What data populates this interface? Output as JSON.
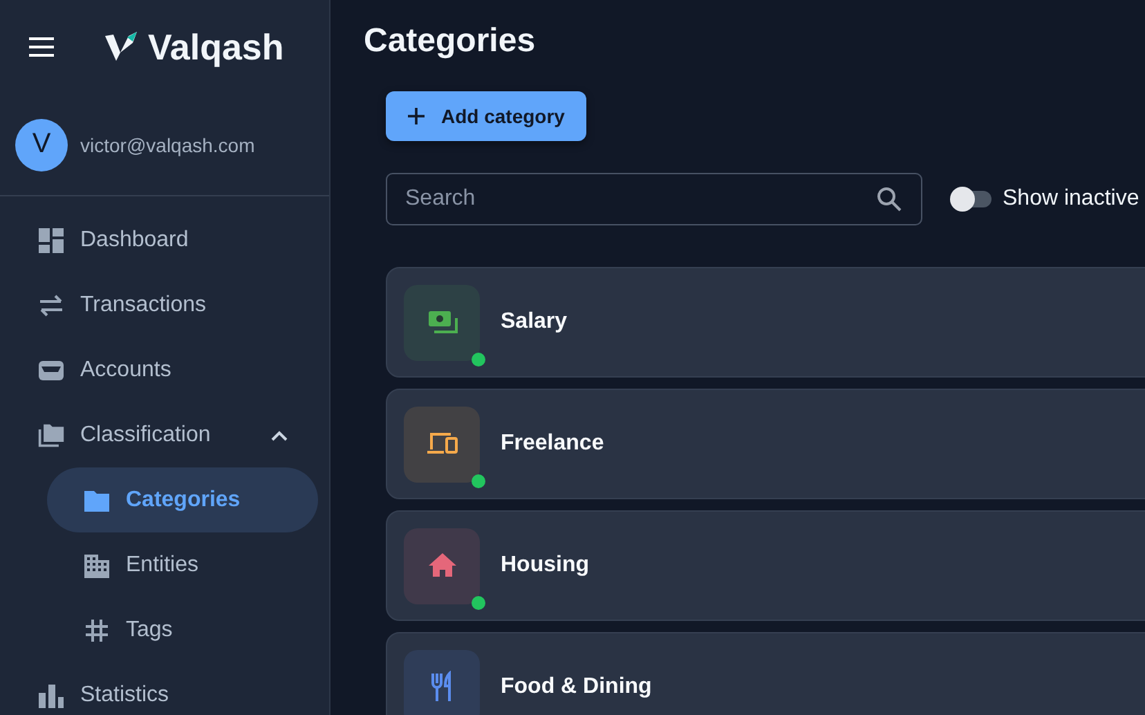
{
  "app": {
    "name": "Valqash"
  },
  "user": {
    "initial": "V",
    "email": "victor@valqash.com"
  },
  "nav": [
    {
      "label": "Dashboard",
      "kind": "dashboard",
      "selected": false
    },
    {
      "label": "Transactions",
      "kind": "transfer",
      "selected": false
    },
    {
      "label": "Accounts",
      "kind": "wallet",
      "selected": false
    },
    {
      "label": "Classification",
      "kind": "folders",
      "selected": false,
      "expanded": true,
      "children": [
        {
          "label": "Categories",
          "kind": "folder",
          "selected": true
        },
        {
          "label": "Entities",
          "kind": "building",
          "selected": false
        },
        {
          "label": "Tags",
          "kind": "hash",
          "selected": false
        }
      ]
    },
    {
      "label": "Statistics",
      "kind": "bars",
      "selected": false
    }
  ],
  "page": {
    "title": "Categories"
  },
  "add_button": {
    "label": "Add category"
  },
  "search": {
    "placeholder": "Search"
  },
  "show_inactive": {
    "label": "Show inactive",
    "on": false
  },
  "categories": [
    {
      "name": "Salary",
      "kind": "money",
      "color": "#4caf50",
      "active": true
    },
    {
      "name": "Freelance",
      "kind": "devices",
      "color": "#f5a94b",
      "active": true
    },
    {
      "name": "Housing",
      "kind": "house",
      "color": "#e5677a",
      "active": true
    },
    {
      "name": "Food & Dining",
      "kind": "cutlery",
      "color": "#5b8def"
    }
  ]
}
